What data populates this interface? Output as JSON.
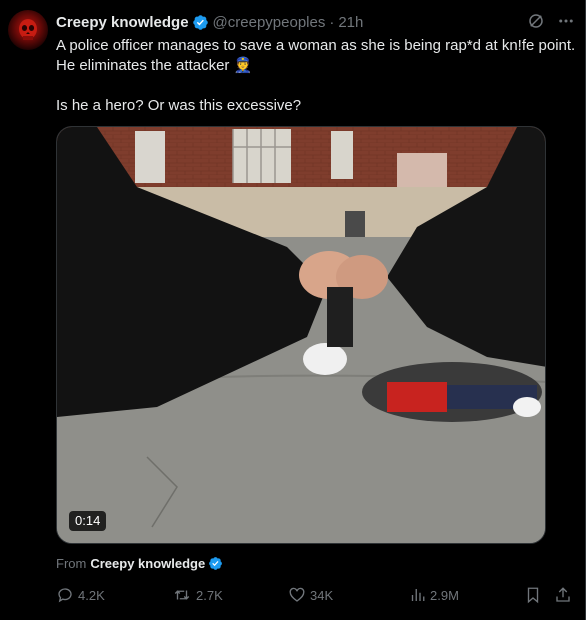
{
  "tweet": {
    "display_name": "Creepy knowledge",
    "handle": "@creepypeoples",
    "separator": "·",
    "time": "21h",
    "text_line_1": "A police officer manages to save a woman as she is being rap*d at kn!fe point. He eliminates the attacker 👮",
    "text_line_2": "Is he a hero? Or was this excessive?",
    "media": {
      "duration": "0:14"
    },
    "from_label": "From",
    "from_name": "Creepy knowledge",
    "stats": {
      "replies": "4.2K",
      "reposts": "2.7K",
      "likes": "34K",
      "views": "2.9M"
    }
  },
  "icons": {
    "verified": "verified-badge-icon",
    "grok": "grok-icon",
    "more": "more-icon",
    "reply": "reply-icon",
    "repost": "repost-icon",
    "like": "like-icon",
    "views": "views-icon",
    "bookmark": "bookmark-icon",
    "share": "share-icon"
  },
  "colors": {
    "background": "#000000",
    "text": "#e7e9ea",
    "muted": "#71767b",
    "verified": "#1d9bf0"
  }
}
